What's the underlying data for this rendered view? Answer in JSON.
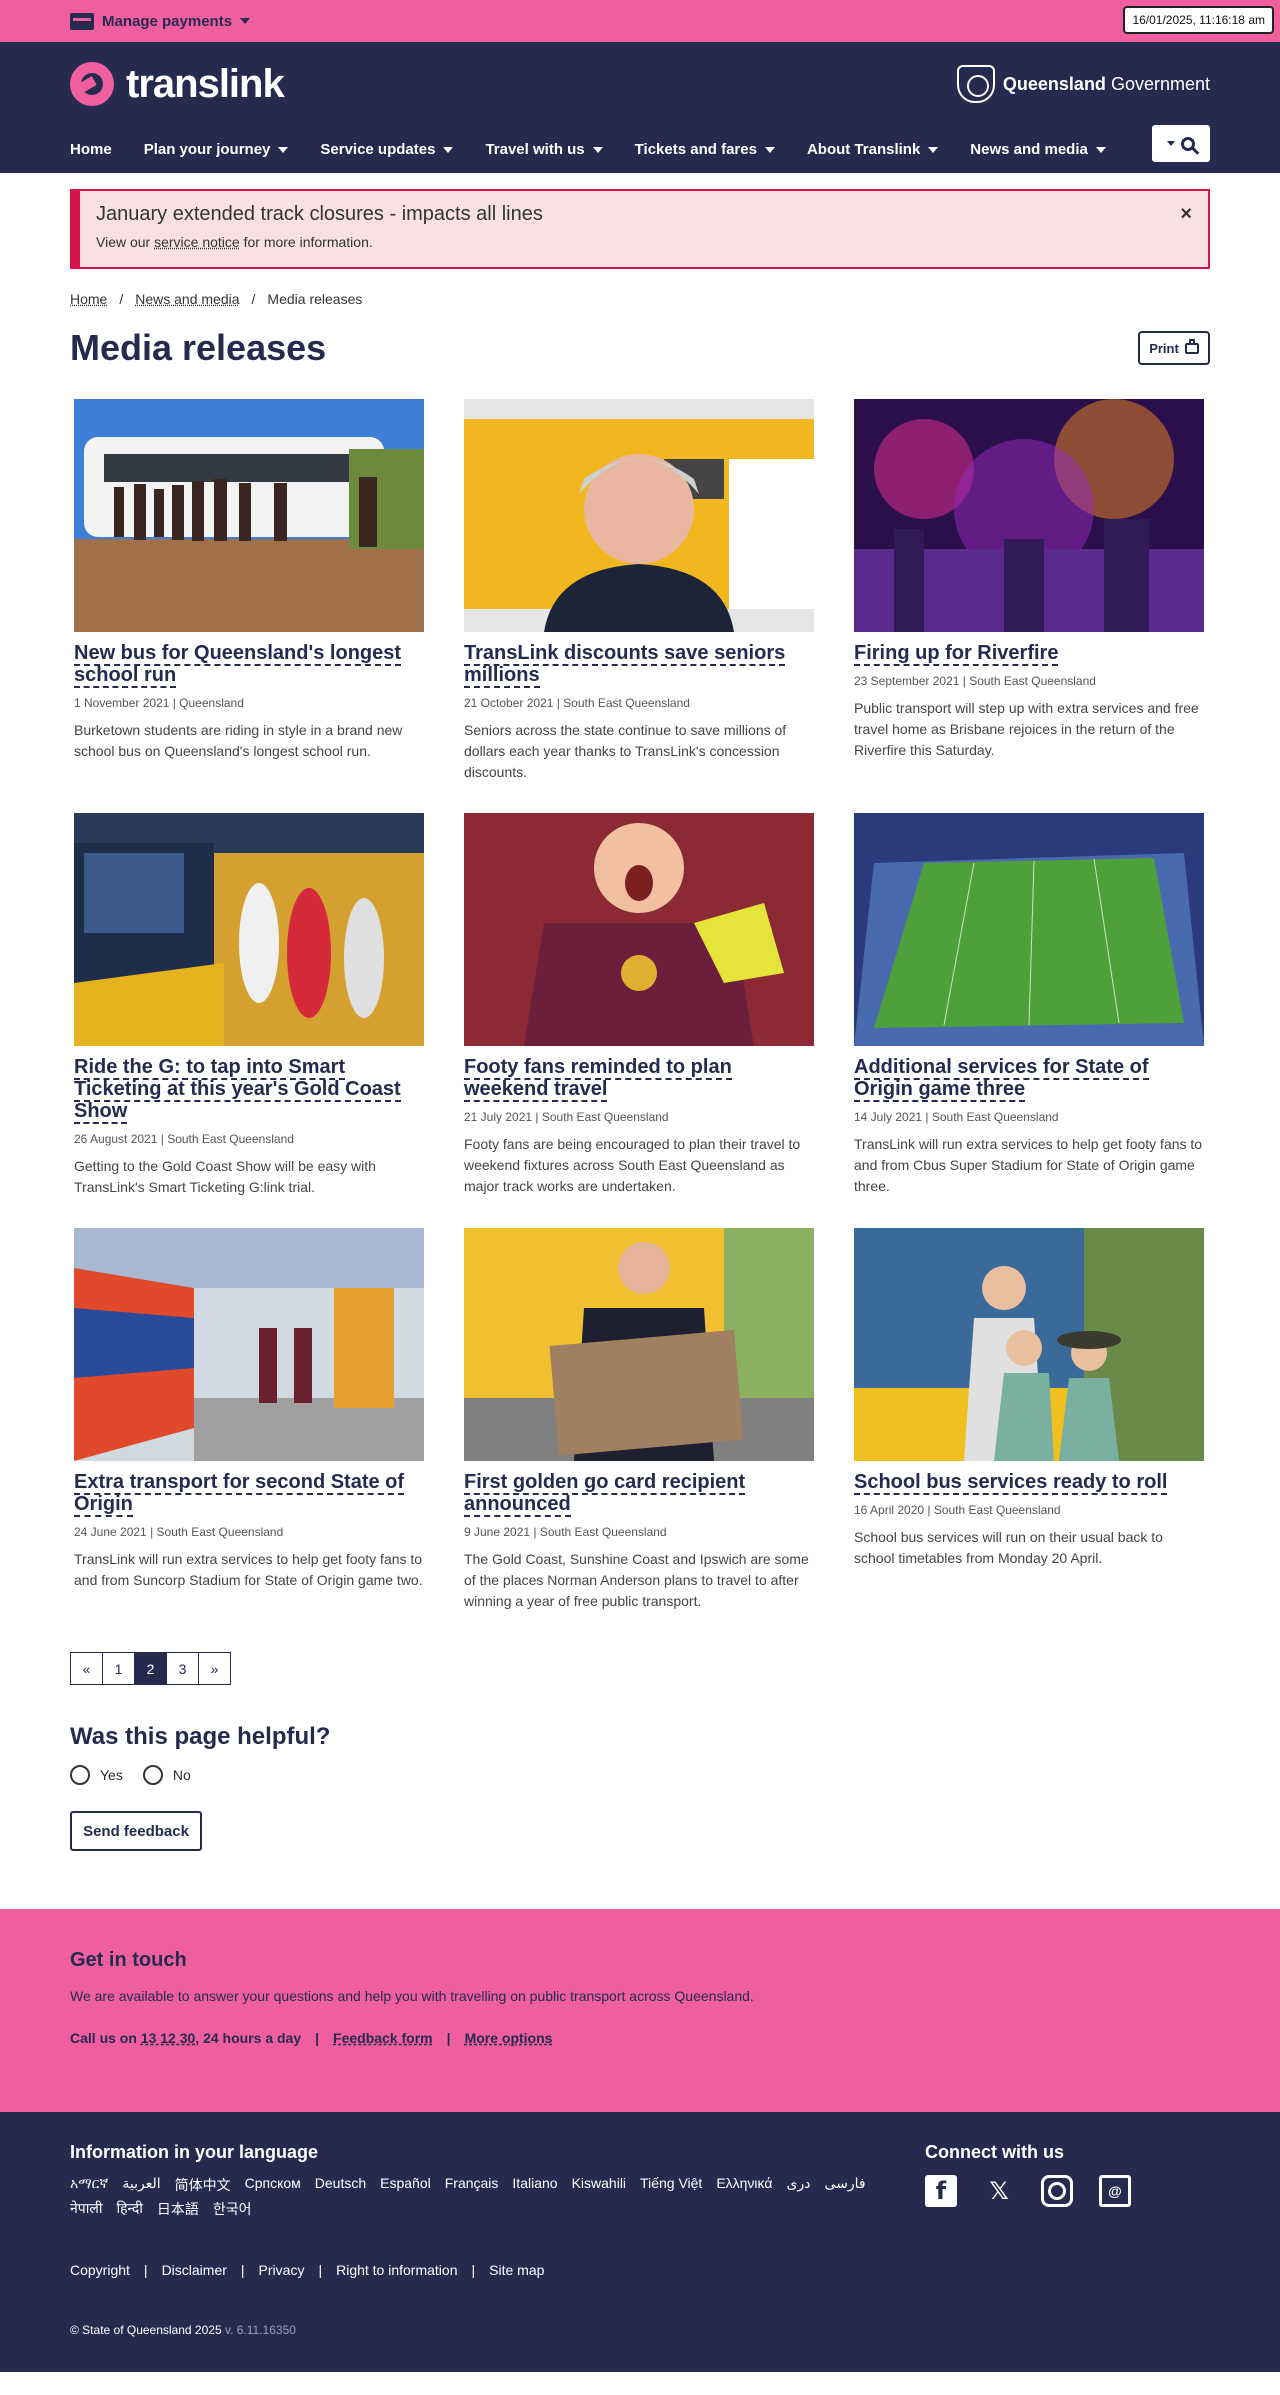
{
  "utility": {
    "manage_payments": "Manage payments",
    "clock": "16/01/2025, 11:16:18 am"
  },
  "header": {
    "logo": "translink",
    "gov_bold": "Queensland",
    "gov_regular": "Government",
    "nav": [
      "Home",
      "Plan your journey",
      "Service updates",
      "Travel with us",
      "Tickets and fares",
      "About Translink",
      "News and media"
    ]
  },
  "alert": {
    "title": "January extended track closures - impacts all lines",
    "text_before": "View our",
    "link": "service notice",
    "text_after": "for more information.",
    "close": "×"
  },
  "breadcrumb": [
    "Home",
    "News and media",
    "Media releases"
  ],
  "page_title": "Media releases",
  "print_label": "Print",
  "cards": [
    {
      "title": "New bus for Queensland's longest school run",
      "meta": "1 November 2021 | Queensland",
      "desc": "Burketown students are riding in style in a brand new school bus on Queensland's longest school run."
    },
    {
      "title": "TransLink discounts save seniors millions",
      "meta": "21 October 2021 | South East Queensland",
      "desc": "Seniors across the state continue to save millions of dollars each year thanks to TransLink's concession discounts."
    },
    {
      "title": "Firing up for Riverfire",
      "meta": "23 September 2021 | South East Queensland",
      "desc": "Public transport will step up with extra services and free travel home as Brisbane rejoices in the return of the Riverfire this Saturday."
    },
    {
      "title": "Ride the G: to tap into Smart Ticketing at this year's Gold Coast Show",
      "meta": "26 August 2021 | South East Queensland",
      "desc": "Getting to the Gold Coast Show will be easy with TransLink's Smart Ticketing G:link trial."
    },
    {
      "title": "Footy fans reminded to plan weekend travel",
      "meta": "21 July 2021 | South East Queensland",
      "desc": "Footy fans are being encouraged to plan their travel to weekend fixtures across South East Queensland as major track works are undertaken."
    },
    {
      "title": "Additional services for State of Origin game three",
      "meta": "14 July 2021 | South East Queensland",
      "desc": "TransLink will run extra services to help get footy fans to and from Cbus Super Stadium for State of Origin game three."
    },
    {
      "title": "Extra transport for second State of Origin",
      "meta": "24 June 2021 | South East Queensland",
      "desc": "TransLink will run extra services to help get footy fans to and from Suncorp Stadium for State of Origin game two."
    },
    {
      "title": "First golden go card recipient announced",
      "meta": "9 June 2021 | South East Queensland",
      "desc": "The Gold Coast, Sunshine Coast and Ipswich are some of the places Norman Anderson plans to travel to after winning a year of free public transport."
    },
    {
      "title": "School bus services ready to roll",
      "meta": "16 April 2020 | South East Queensland",
      "desc": "School bus services will run on their usual back to school timetables from Monday 20 April."
    }
  ],
  "pagination": [
    "«",
    "1",
    "2",
    "3",
    "»"
  ],
  "current_page": "2",
  "helpful": {
    "question": "Was this page helpful?",
    "yes": "Yes",
    "no": "No",
    "send": "Send feedback"
  },
  "touch": {
    "title": "Get in touch",
    "text": "We are available to answer your questions and help you with travelling on public transport across Queensland.",
    "call_prefix": "Call us on",
    "call_link": "13 12 30",
    "call_suffix": ", 24 hours a day",
    "feedback": "Feedback form",
    "more": "More options"
  },
  "footer": {
    "lang_title": "Information in your language",
    "languages": [
      "አማርኛ",
      "العربية",
      "简体中文",
      "Српском",
      "Deutsch",
      "Español",
      "Français",
      "Italiano",
      "Kiswahili",
      "Tiếng Việt",
      "Ελληνικά",
      "دری",
      "فارسی",
      "नेपाली",
      "हिन्दी",
      "日本語",
      "한국어"
    ],
    "connect_title": "Connect with us",
    "links": [
      "Copyright",
      "Disclaimer",
      "Privacy",
      "Right to information",
      "Site map"
    ],
    "copyright": "© State of Queensland 2025",
    "version": "v. 6.11.16350"
  },
  "colors": {
    "navy": "#262a4f",
    "pink": "#ef5fa0",
    "alert_red": "#d7154a"
  },
  "icons": [
    "card-icon",
    "search-icon",
    "print-icon",
    "close-icon",
    "facebook-icon",
    "x-icon",
    "instagram-icon",
    "email-icon"
  ]
}
